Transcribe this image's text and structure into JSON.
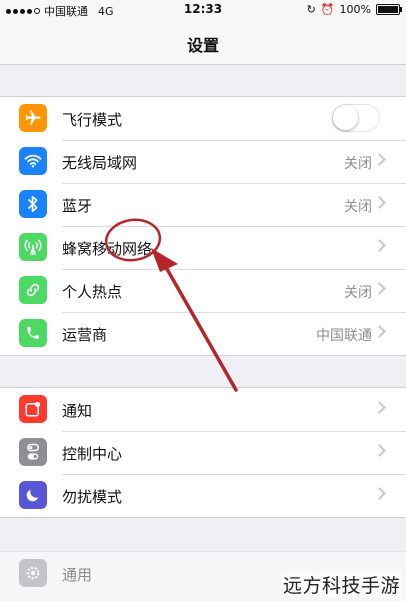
{
  "status_bar": {
    "carrier": "中国联通",
    "network": "4G",
    "time": "12:33",
    "battery": "100%"
  },
  "nav": {
    "title": "设置"
  },
  "groups": [
    {
      "items": [
        {
          "label": "飞行模式",
          "icon": "airplane-icon",
          "icon_color": "#ff9500",
          "control": "toggle",
          "toggle_on": false
        },
        {
          "label": "无线局域网",
          "icon": "wifi-icon",
          "icon_color": "#1a82fb",
          "value": "关闭"
        },
        {
          "label": "蓝牙",
          "icon": "bluetooth-icon",
          "icon_color": "#1a82fb",
          "value": "关闭"
        },
        {
          "label": "蜂窝移动网络",
          "icon": "cellular-antenna-icon",
          "icon_color": "#4cd964",
          "value": ""
        },
        {
          "label": "个人热点",
          "icon": "hotspot-icon",
          "icon_color": "#4cd964",
          "value": "关闭"
        },
        {
          "label": "运营商",
          "icon": "phone-icon",
          "icon_color": "#4cd964",
          "value": "中国联通"
        }
      ]
    },
    {
      "items": [
        {
          "label": "通知",
          "icon": "notifications-icon",
          "icon_color": "#ff3b30"
        },
        {
          "label": "控制中心",
          "icon": "control-center-icon",
          "icon_color": "#8e8e93"
        },
        {
          "label": "勿扰模式",
          "icon": "moon-icon",
          "icon_color": "#5856d6"
        }
      ]
    },
    {
      "items": [
        {
          "label": "通用",
          "icon": "gear-icon",
          "icon_color": "#8e8e93"
        }
      ]
    }
  ],
  "watermark": "远方科技手游",
  "annotation_color": "#b3262a"
}
